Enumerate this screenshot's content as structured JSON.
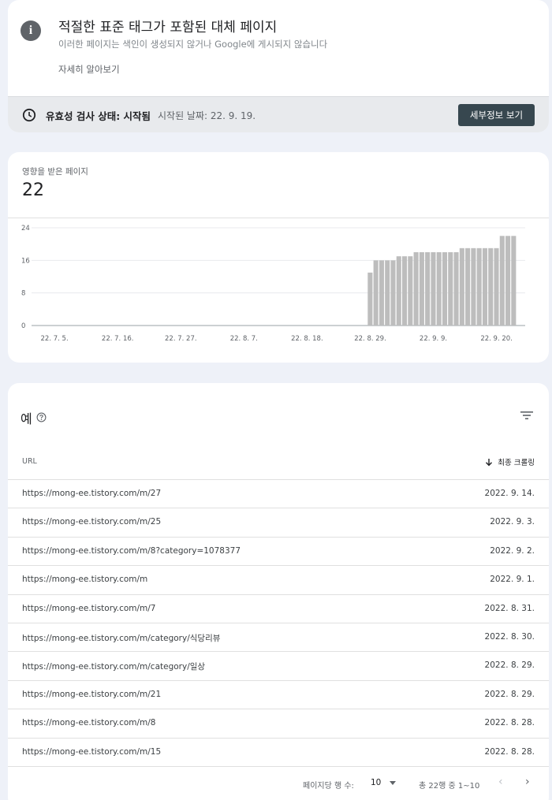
{
  "issue": {
    "info_icon": "info-icon",
    "title": "적절한 표준 태그가 포함된 대체 페이지",
    "subtitle": "이러한 페이지는 색인이 생성되지 않거나 Google에 게시되지 않습니다",
    "learn_more": "자세히 알아보기"
  },
  "validation": {
    "icon": "clock-icon",
    "status_label": "유효성 검사 상태: 시작됨",
    "started_label": "시작된 날짜: 22. 9. 19.",
    "details_button": "세부정보 보기"
  },
  "affected": {
    "label": "영향을 받은 페이지",
    "count": "22"
  },
  "chart_data": {
    "type": "bar",
    "y_ticks": [
      "0",
      "8",
      "16",
      "24"
    ],
    "ylim": [
      0,
      24
    ],
    "x_tick_labels": [
      "22. 7. 5.",
      "22. 7. 16.",
      "22. 7. 27.",
      "22. 8. 7.",
      "22. 8. 18.",
      "22. 8. 29.",
      "22. 9. 9.",
      "22. 9. 20."
    ],
    "categories": [
      "22. 8. 29.",
      "22. 8. 30.",
      "22. 8. 31.",
      "22. 9. 1.",
      "22. 9. 2.",
      "22. 9. 3.",
      "22. 9. 4.",
      "22. 9. 5.",
      "22. 9. 6.",
      "22. 9. 7.",
      "22. 9. 8.",
      "22. 9. 9.",
      "22. 9. 10.",
      "22. 9. 11.",
      "22. 9. 12.",
      "22. 9. 13.",
      "22. 9. 14.",
      "22. 9. 15.",
      "22. 9. 16.",
      "22. 9. 17.",
      "22. 9. 18.",
      "22. 9. 19.",
      "22. 9. 20.",
      "22. 9. 21.",
      "22. 9. 22.",
      "22. 9. 23."
    ],
    "values": [
      13,
      16,
      16,
      16,
      16,
      17,
      17,
      17,
      18,
      18,
      18,
      18,
      18,
      18,
      18,
      18,
      19,
      19,
      19,
      19,
      19,
      19,
      19,
      22,
      22,
      22
    ],
    "x_domain": [
      "22. 7. 1.",
      "22. 9. 25."
    ],
    "bar_color": "#bdbdbd",
    "grid": true
  },
  "examples": {
    "title": "예",
    "help_icon": "help-icon",
    "filter_icon": "filter-icon",
    "col_url": "URL",
    "col_crawl": "최종 크롤링",
    "sort_icon": "arrow-down-icon",
    "rows": [
      {
        "url": "https://mong-ee.tistory.com/m/27",
        "date": "2022. 9. 14."
      },
      {
        "url": "https://mong-ee.tistory.com/m/25",
        "date": "2022. 9. 3."
      },
      {
        "url": "https://mong-ee.tistory.com/m/8?category=1078377",
        "date": "2022. 9. 2."
      },
      {
        "url": "https://mong-ee.tistory.com/m",
        "date": "2022. 9. 1."
      },
      {
        "url": "https://mong-ee.tistory.com/m/7",
        "date": "2022. 8. 31."
      },
      {
        "url": "https://mong-ee.tistory.com/m/category/식당리뷰",
        "date": "2022. 8. 30."
      },
      {
        "url": "https://mong-ee.tistory.com/m/category/일상",
        "date": "2022. 8. 29."
      },
      {
        "url": "https://mong-ee.tistory.com/m/21",
        "date": "2022. 8. 29."
      },
      {
        "url": "https://mong-ee.tistory.com/m/8",
        "date": "2022. 8. 28."
      },
      {
        "url": "https://mong-ee.tistory.com/m/15",
        "date": "2022. 8. 28."
      }
    ]
  },
  "pagination": {
    "rows_per_page_label": "페이지당 행 수:",
    "rows_per_page_value": "10",
    "range_label": "총 22행 중 1~10",
    "prev_icon": "chevron-left-icon",
    "next_icon": "chevron-right-icon"
  }
}
